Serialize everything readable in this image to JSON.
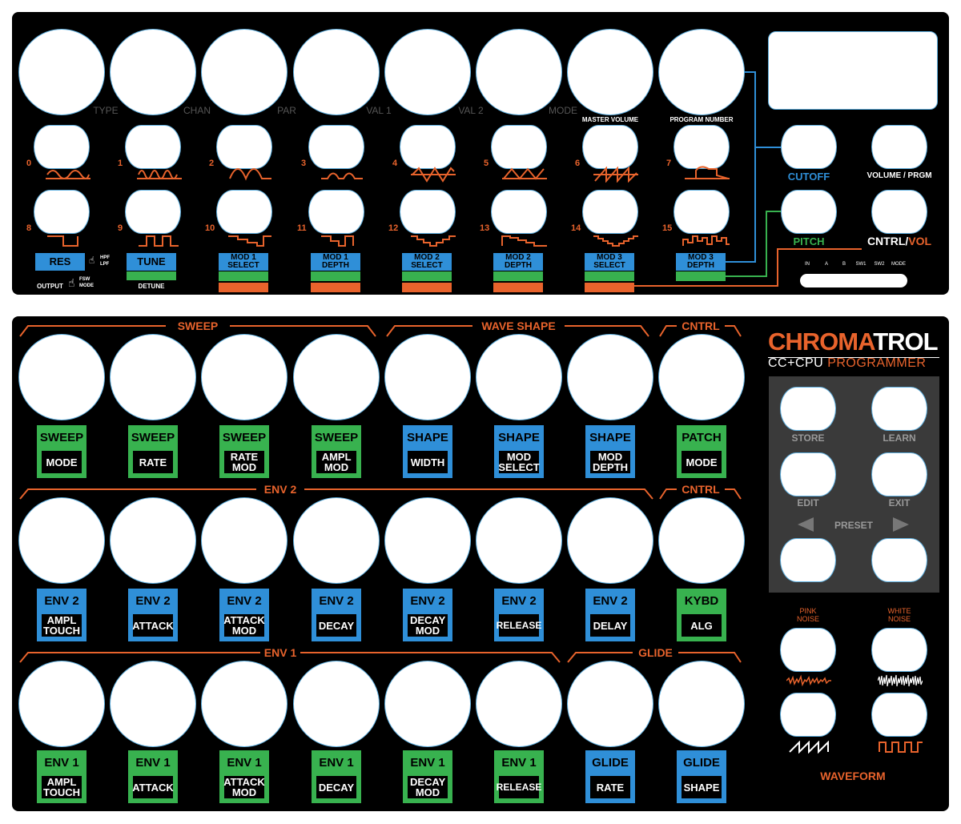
{
  "colors": {
    "orange": "#e8632c",
    "blue": "#2f8fd8",
    "green": "#38b24f",
    "panel": "#000000",
    "dark_gray": "#3a3a3a"
  },
  "top_panel": {
    "knob_labels": [
      "TYPE",
      "CHAN",
      "PAR",
      "VAL 1",
      "VAL 2",
      "MODE"
    ],
    "master_volume": "MASTER VOLUME",
    "program_number": "PROGRAM NUMBER",
    "row1_numbers": [
      "0",
      "1",
      "2",
      "3",
      "4",
      "5",
      "6",
      "7"
    ],
    "row2_numbers": [
      "8",
      "9",
      "10",
      "11",
      "12",
      "13",
      "14",
      "15"
    ],
    "cutoff": "CUTOFF",
    "volume_prgm": "VOLUME / PRGM",
    "pitch": "PITCH",
    "cntrl": "CNTRL",
    "slash": "/",
    "vol": "VOL",
    "footswitch_labels": [
      "IN",
      "A",
      "B",
      "SW1",
      "SW2",
      "MODE"
    ],
    "tags": [
      {
        "line1": "RES",
        "line2": ""
      },
      {
        "line1": "TUNE",
        "line2": ""
      },
      {
        "line1": "MOD 1",
        "line2": "SELECT"
      },
      {
        "line1": "MOD 1",
        "line2": "DEPTH"
      },
      {
        "line1": "MOD 2",
        "line2": "SELECT"
      },
      {
        "line1": "MOD 2",
        "line2": "DEPTH"
      },
      {
        "line1": "MOD 3",
        "line2": "SELECT"
      },
      {
        "line1": "MOD 3",
        "line2": "DEPTH"
      }
    ],
    "hpf": "HPF",
    "lpf": "LPF",
    "output": "OUTPUT",
    "fsw": "FSW",
    "fsw_mode": "MODE",
    "detune": "DETUNE"
  },
  "bottom_panel": {
    "sections": {
      "sweep": "SWEEP",
      "wave_shape": "WAVE SHAPE",
      "cntrl1": "CNTRL",
      "env2": "ENV 2",
      "cntrl2": "CNTRL",
      "env1": "ENV 1",
      "glide": "GLIDE"
    },
    "row1": [
      {
        "top": "SWEEP",
        "bottom": "MODE",
        "color": "green"
      },
      {
        "top": "SWEEP",
        "bottom": "RATE",
        "color": "green"
      },
      {
        "top": "SWEEP",
        "bottom": "RATE MOD",
        "color": "green"
      },
      {
        "top": "SWEEP",
        "bottom": "AMPL MOD",
        "color": "green"
      },
      {
        "top": "SHAPE",
        "bottom": "WIDTH",
        "color": "blue"
      },
      {
        "top": "SHAPE",
        "bottom": "MOD SELECT",
        "color": "blue"
      },
      {
        "top": "SHAPE",
        "bottom": "MOD DEPTH",
        "color": "blue"
      },
      {
        "top": "PATCH",
        "bottom": "MODE",
        "color": "green"
      }
    ],
    "row2": [
      {
        "top": "ENV 2",
        "bottom": "AMPL TOUCH",
        "color": "blue"
      },
      {
        "top": "ENV 2",
        "bottom": "ATTACK",
        "color": "blue"
      },
      {
        "top": "ENV 2",
        "bottom": "ATTACK MOD",
        "color": "blue"
      },
      {
        "top": "ENV 2",
        "bottom": "DECAY",
        "color": "blue"
      },
      {
        "top": "ENV 2",
        "bottom": "DECAY MOD",
        "color": "blue"
      },
      {
        "top": "ENV 2",
        "bottom": "RELEASE",
        "color": "blue"
      },
      {
        "top": "ENV 2",
        "bottom": "DELAY",
        "color": "blue"
      },
      {
        "top": "KYBD",
        "bottom": "ALG",
        "color": "green"
      }
    ],
    "row3": [
      {
        "top": "ENV 1",
        "bottom": "AMPL TOUCH",
        "color": "green"
      },
      {
        "top": "ENV 1",
        "bottom": "ATTACK",
        "color": "green"
      },
      {
        "top": "ENV 1",
        "bottom": "ATTACK MOD",
        "color": "green"
      },
      {
        "top": "ENV 1",
        "bottom": "DECAY",
        "color": "green"
      },
      {
        "top": "ENV 1",
        "bottom": "DECAY MOD",
        "color": "green"
      },
      {
        "top": "ENV 1",
        "bottom": "RELEASE",
        "color": "green"
      },
      {
        "top": "GLIDE",
        "bottom": "RATE",
        "color": "blue"
      },
      {
        "top": "GLIDE",
        "bottom": "SHAPE",
        "color": "blue"
      }
    ],
    "logo_chroma": "CHROMA",
    "logo_trol": "TROL",
    "subtitle_a": "CC+CPU",
    "subtitle_b": "PROGRAMMER",
    "store": "STORE",
    "learn": "LEARN",
    "edit": "EDIT",
    "exit": "EXIT",
    "preset": "PRESET",
    "pink_noise": "PINK NOISE",
    "white_noise": "WHITE NOISE",
    "waveform": "WAVEFORM"
  }
}
